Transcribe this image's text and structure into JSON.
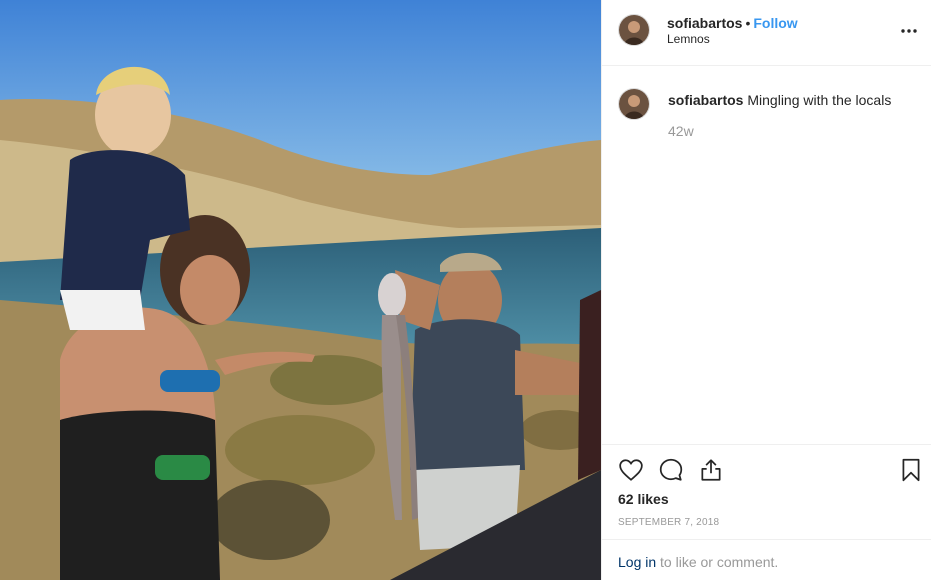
{
  "post": {
    "username": "sofiabartos",
    "separator": "•",
    "follow_label": "Follow",
    "location": "Lemnos",
    "more_icon": "more-horizontal-icon"
  },
  "caption": {
    "username": "sofiabartos",
    "text": "Mingling with the locals",
    "time": "42w"
  },
  "actions": {
    "icons": [
      "heart-icon",
      "comment-icon",
      "share-icon",
      "bookmark-icon"
    ],
    "likes": "62 likes",
    "date": "SEPTEMBER 7, 2018"
  },
  "login": {
    "link": "Log in",
    "rest": " to like or comment."
  },
  "colors": {
    "link_blue": "#3897f0",
    "login_blue": "#003569",
    "muted": "#999999",
    "border": "#efefef"
  }
}
